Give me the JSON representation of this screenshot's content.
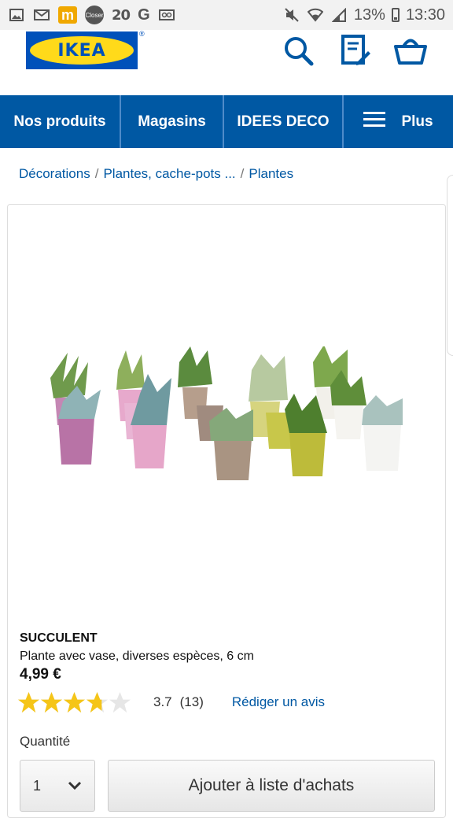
{
  "status_bar": {
    "battery_pct": "13%",
    "time": "13:30",
    "notif_number": "20",
    "closer_label": "Closer"
  },
  "header": {
    "logo_text": "IKEA",
    "logo_reg": "®",
    "icons": [
      "search-icon",
      "shopping-list-icon",
      "basket-icon"
    ]
  },
  "nav": {
    "items": [
      "Nos produits",
      "Magasins",
      "IDEES DECO"
    ],
    "more_label": "Plus"
  },
  "breadcrumb": {
    "items": [
      "Décorations",
      "Plantes, cache-pots ...",
      "Plantes"
    ],
    "separator": "/"
  },
  "product": {
    "name": "SUCCULENT",
    "description": "Plante avec vase, diverses espèces, 6 cm",
    "price": "4,99 €",
    "rating": 3.7,
    "rating_text": "3.7",
    "reviews": "(13)",
    "review_link": "Rédiger un avis",
    "max_stars": 5
  },
  "purchase": {
    "quantity_label": "Quantité",
    "quantity_value": "1",
    "add_button": "Ajouter à liste d'achats"
  },
  "colors": {
    "ikea_blue": "#0058a3",
    "logo_blue": "#0051ba",
    "ikea_yellow": "#ffda1a",
    "star_yellow": "#f5c518"
  }
}
